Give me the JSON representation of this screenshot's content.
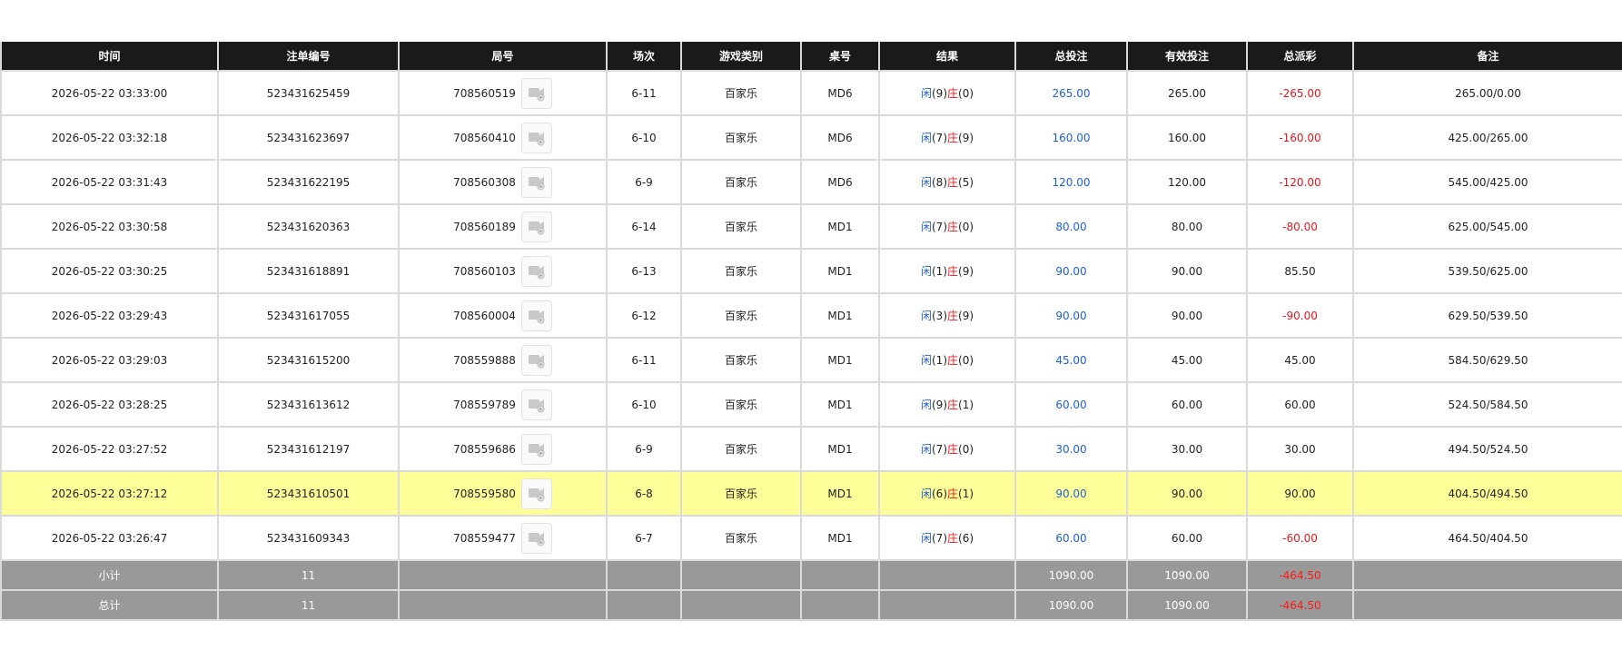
{
  "headers": [
    "时间",
    "注单编号",
    "局号",
    "场次",
    "游戏类别",
    "桌号",
    "结果",
    "总投注",
    "有效投注",
    "总派彩",
    "备注"
  ],
  "result_labels": {
    "player": "闲",
    "banker": "庄"
  },
  "icons": {
    "replay": "video-replay-icon"
  },
  "colors": {
    "header_bg": "#1a1a1a",
    "highlight": "#ffff9a",
    "summary_bg": "#999999",
    "blue": "#1e5fd8",
    "red": "#e8161b"
  },
  "rows": [
    {
      "time": "2026-05-22 03:33:00",
      "bet_id": "523431625459",
      "game_no": "708560519",
      "round": "6-11",
      "game_type": "百家乐",
      "table": "MD6",
      "player": "(9)",
      "banker": "(0)",
      "total_bet": "265.00",
      "valid_bet": "265.00",
      "payout": "-265.00",
      "note": "265.00/0.00"
    },
    {
      "time": "2026-05-22 03:32:18",
      "bet_id": "523431623697",
      "game_no": "708560410",
      "round": "6-10",
      "game_type": "百家乐",
      "table": "MD6",
      "player": "(7)",
      "banker": "(9)",
      "total_bet": "160.00",
      "valid_bet": "160.00",
      "payout": "-160.00",
      "note": "425.00/265.00"
    },
    {
      "time": "2026-05-22 03:31:43",
      "bet_id": "523431622195",
      "game_no": "708560308",
      "round": "6-9",
      "game_type": "百家乐",
      "table": "MD6",
      "player": "(8)",
      "banker": "(5)",
      "total_bet": "120.00",
      "valid_bet": "120.00",
      "payout": "-120.00",
      "note": "545.00/425.00"
    },
    {
      "time": "2026-05-22 03:30:58",
      "bet_id": "523431620363",
      "game_no": "708560189",
      "round": "6-14",
      "game_type": "百家乐",
      "table": "MD1",
      "player": "(7)",
      "banker": "(0)",
      "total_bet": "80.00",
      "valid_bet": "80.00",
      "payout": "-80.00",
      "note": "625.00/545.00"
    },
    {
      "time": "2026-05-22 03:30:25",
      "bet_id": "523431618891",
      "game_no": "708560103",
      "round": "6-13",
      "game_type": "百家乐",
      "table": "MD1",
      "player": "(1)",
      "banker": "(9)",
      "total_bet": "90.00",
      "valid_bet": "90.00",
      "payout": "85.50",
      "note": "539.50/625.00"
    },
    {
      "time": "2026-05-22 03:29:43",
      "bet_id": "523431617055",
      "game_no": "708560004",
      "round": "6-12",
      "game_type": "百家乐",
      "table": "MD1",
      "player": "(3)",
      "banker": "(9)",
      "total_bet": "90.00",
      "valid_bet": "90.00",
      "payout": "-90.00",
      "note": "629.50/539.50"
    },
    {
      "time": "2026-05-22 03:29:03",
      "bet_id": "523431615200",
      "game_no": "708559888",
      "round": "6-11",
      "game_type": "百家乐",
      "table": "MD1",
      "player": "(1)",
      "banker": "(0)",
      "total_bet": "45.00",
      "valid_bet": "45.00",
      "payout": "45.00",
      "note": "584.50/629.50"
    },
    {
      "time": "2026-05-22 03:28:25",
      "bet_id": "523431613612",
      "game_no": "708559789",
      "round": "6-10",
      "game_type": "百家乐",
      "table": "MD1",
      "player": "(9)",
      "banker": "(1)",
      "total_bet": "60.00",
      "valid_bet": "60.00",
      "payout": "60.00",
      "note": "524.50/584.50"
    },
    {
      "time": "2026-05-22 03:27:52",
      "bet_id": "523431612197",
      "game_no": "708559686",
      "round": "6-9",
      "game_type": "百家乐",
      "table": "MD1",
      "player": "(7)",
      "banker": "(0)",
      "total_bet": "30.00",
      "valid_bet": "30.00",
      "payout": "30.00",
      "note": "494.50/524.50"
    },
    {
      "time": "2026-05-22 03:27:12",
      "bet_id": "523431610501",
      "game_no": "708559580",
      "round": "6-8",
      "game_type": "百家乐",
      "table": "MD1",
      "player": "(6)",
      "banker": "(1)",
      "total_bet": "90.00",
      "valid_bet": "90.00",
      "payout": "90.00",
      "note": "404.50/494.50",
      "highlight": true
    },
    {
      "time": "2026-05-22 03:26:47",
      "bet_id": "523431609343",
      "game_no": "708559477",
      "round": "6-7",
      "game_type": "百家乐",
      "table": "MD1",
      "player": "(7)",
      "banker": "(6)",
      "total_bet": "60.00",
      "valid_bet": "60.00",
      "payout": "-60.00",
      "note": "464.50/404.50"
    }
  ],
  "subtotal": {
    "label": "小计",
    "count": "11",
    "total_bet": "1090.00",
    "valid_bet": "1090.00",
    "payout": "-464.50"
  },
  "total": {
    "label": "总计",
    "count": "11",
    "total_bet": "1090.00",
    "valid_bet": "1090.00",
    "payout": "-464.50"
  }
}
